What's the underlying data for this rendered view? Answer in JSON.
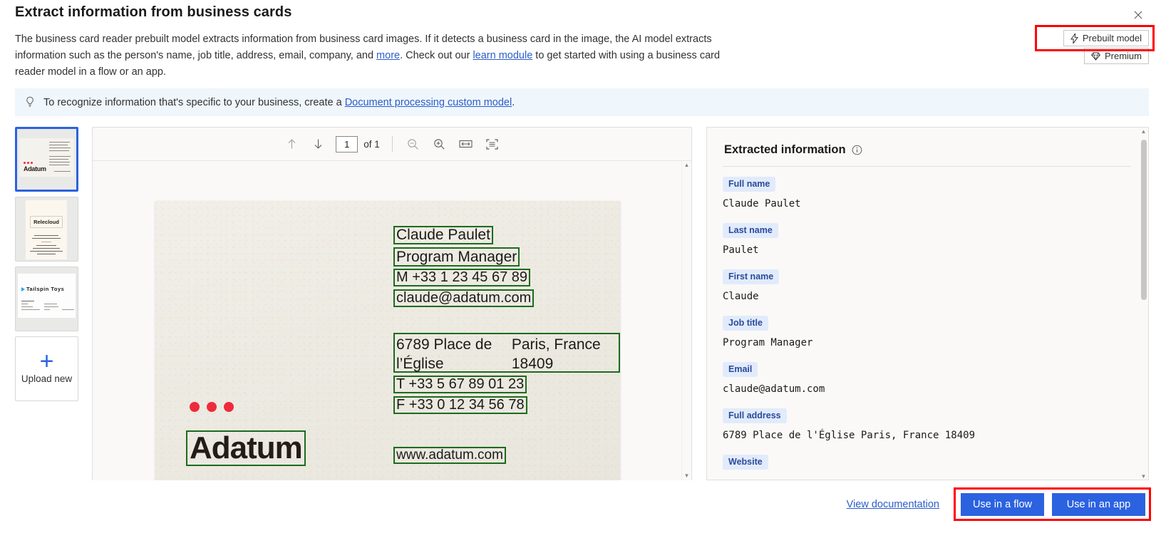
{
  "dialog": {
    "title": "Extract information from business cards",
    "close_icon": "close-icon"
  },
  "description": {
    "part1": "The business card reader prebuilt model extracts information from business card images. If it detects a business card in the image, the AI model extracts information such as the person's name, job title, address, email, company, and ",
    "link_more": "more",
    "part2": ". Check out our ",
    "link_learn": "learn module",
    "part3": " to get started with using a business card reader model in a flow or an app."
  },
  "badges": [
    {
      "label": "Prebuilt model",
      "icon": "lightning-bolt-icon"
    },
    {
      "label": "Premium",
      "icon": "diamond-icon"
    }
  ],
  "info_banner": {
    "icon": "lightbulb-icon",
    "text_before": "To recognize information that's specific to your business, create a ",
    "link": "Document processing custom model",
    "text_after": "."
  },
  "thumbnails": [
    {
      "name": "Adatum",
      "selected": true
    },
    {
      "name": "Relecloud",
      "selected": false
    },
    {
      "name": "Tailspin Toys",
      "selected": false
    }
  ],
  "upload": {
    "label": "Upload new",
    "icon": "plus-icon"
  },
  "viewer_toolbar": {
    "prev_icon": "arrow-up-icon",
    "next_icon": "arrow-down-icon",
    "page_value": "1",
    "page_total": "of 1",
    "zoom_out_icon": "zoom-out-icon",
    "zoom_in_icon": "zoom-in-icon",
    "fit_width_icon": "fit-width-icon",
    "fit_page_icon": "fit-page-icon"
  },
  "card_ocr": {
    "name": "Claude Paulet",
    "job_title": "Program Manager",
    "mobile": "M +33 1 23 45 67 89",
    "email": "claude@adatum.com",
    "address_line1": "6789 Place de l’Église",
    "address_line2": "Paris, France 18409",
    "tel": "T +33 5 67 89 01 23",
    "fax": "F +33 0 12 34 56 78",
    "website": "www.adatum.com",
    "logo": "Adatum"
  },
  "panel": {
    "title": "Extracted information",
    "info_icon": "info-circle-icon",
    "fields": [
      {
        "tag": "Full name",
        "value": "Claude Paulet"
      },
      {
        "tag": "Last name",
        "value": "Paulet"
      },
      {
        "tag": "First name",
        "value": "Claude"
      },
      {
        "tag": "Job title",
        "value": "Program Manager"
      },
      {
        "tag": "Email",
        "value": "claude@adatum.com"
      },
      {
        "tag": "Full address",
        "value": "6789 Place de l'Église Paris, France 18409"
      },
      {
        "tag": "Website",
        "value": ""
      }
    ]
  },
  "footer": {
    "doc_link": "View documentation",
    "use_in_flow": "Use in a flow",
    "use_in_app": "Use in an app"
  },
  "colors": {
    "accent": "#2b62e0",
    "link": "#2b5dc9",
    "tag_bg": "#e1ebfb",
    "tag_fg": "#2b4a9b",
    "ocr_box": "#1d6b1d",
    "highlight": "#ff0000",
    "banner_bg": "#eff6fc"
  }
}
